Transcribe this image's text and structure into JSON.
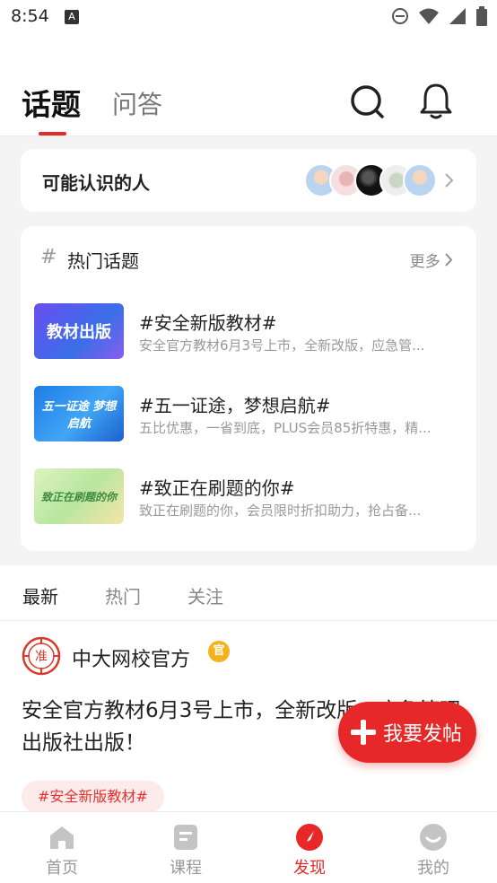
{
  "status_bar": {
    "time": "8:54",
    "notification_letter": "A"
  },
  "header": {
    "tab_topics": "话题",
    "tab_qa": "问答",
    "search_icon": "search-icon",
    "bell_icon": "bell-icon"
  },
  "people_card": {
    "title": "可能认识的人"
  },
  "hot_topics": {
    "title": "热门话题",
    "more": "更多",
    "items": [
      {
        "image_text": "教材出版",
        "title": "#安全新版教材#",
        "desc": "安全官方教材6月3号上市，全新改版，应急管..."
      },
      {
        "image_text": "五一证途 梦想启航",
        "title": "#五一证途，梦想启航#",
        "desc": "五比优惠，一省到底，PLUS会员85折特惠，精..."
      },
      {
        "image_text": "致正在刷题的你",
        "title": "#致正在刷题的你#",
        "desc": "致正在刷题的你，会员限时折扣助力，抢占备..."
      }
    ]
  },
  "feed_tabs": [
    {
      "label": "最新",
      "active": true
    },
    {
      "label": "热门",
      "active": false
    },
    {
      "label": "关注",
      "active": false
    }
  ],
  "post": {
    "avatar_text": "准",
    "author": "中大网校官方",
    "badge": "官",
    "text": "安全官方教材6月3号上市，全新改版，应急管理出版社出版！",
    "tag": "#安全新版教材#"
  },
  "fab": {
    "label": "我要发帖"
  },
  "bottom_nav": [
    {
      "label": "首页",
      "icon": "home-icon",
      "active": false
    },
    {
      "label": "课程",
      "icon": "course-icon",
      "active": false
    },
    {
      "label": "发现",
      "icon": "discover-icon",
      "active": true
    },
    {
      "label": "我的",
      "icon": "profile-icon",
      "active": false
    }
  ],
  "colors": {
    "accent": "#e62828",
    "badge": "#f6b21c",
    "tag_bg": "#fdeaea"
  }
}
